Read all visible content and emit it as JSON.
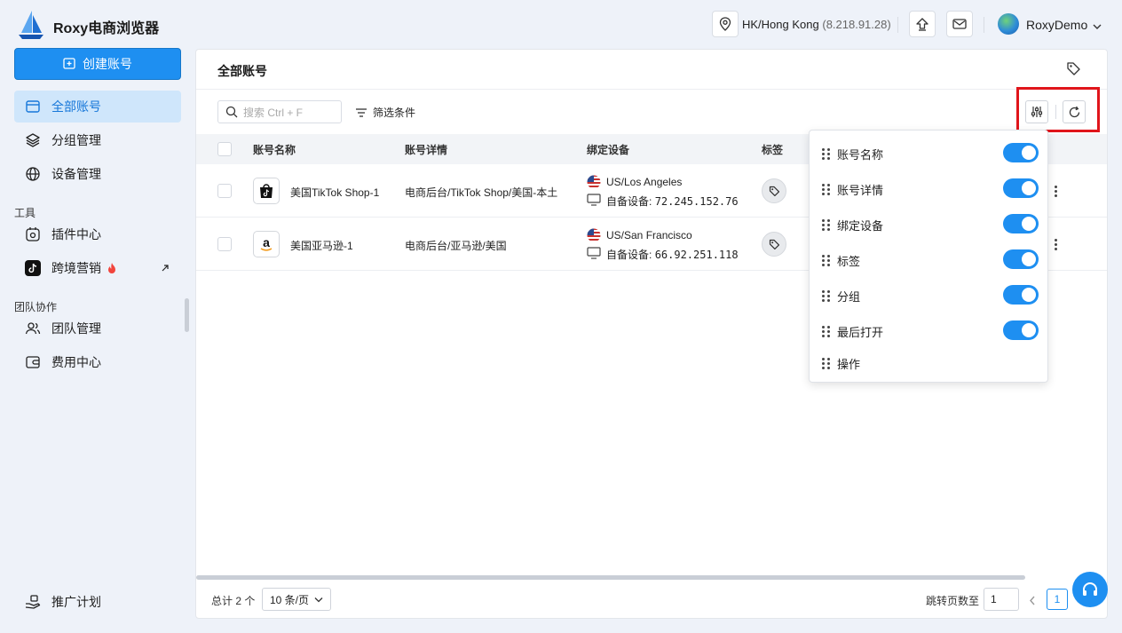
{
  "app": {
    "name": "Roxy电商浏览器"
  },
  "header": {
    "location": "HK/Hong Kong",
    "ip": "(8.218.91.28)",
    "user": "RoxyDemo"
  },
  "sidebar": {
    "create_button": "创建账号",
    "items": [
      {
        "label": "全部账号",
        "active": true
      },
      {
        "label": "分组管理"
      },
      {
        "label": "设备管理"
      }
    ],
    "section_tools": "工具",
    "tools": [
      {
        "label": "插件中心"
      },
      {
        "label": "跨境营销"
      }
    ],
    "section_team": "团队协作",
    "team": [
      {
        "label": "团队管理"
      },
      {
        "label": "费用中心"
      }
    ],
    "bottom_item": "推广计划"
  },
  "main": {
    "title": "全部账号",
    "search_placeholder": "搜索 Ctrl + F",
    "filter_label": "筛选条件",
    "columns": [
      "账号名称",
      "账号详情",
      "绑定设备",
      "标签"
    ],
    "rows": [
      {
        "icon": "tiktok-shop-icon",
        "name": "美国TikTok Shop-1",
        "detail": "电商后台/TikTok Shop/美国-本土",
        "location": "US/Los Angeles",
        "device_label": "自备设备:",
        "device_ip": "72.245.152.76"
      },
      {
        "icon": "amazon-icon",
        "name": "美国亚马逊-1",
        "detail": "电商后台/亚马逊/美国",
        "location": "US/San Francisco",
        "device_label": "自备设备:",
        "device_ip": "66.92.251.118"
      }
    ]
  },
  "column_settings": {
    "items": [
      {
        "label": "账号名称",
        "enabled": true
      },
      {
        "label": "账号详情",
        "enabled": true
      },
      {
        "label": "绑定设备",
        "enabled": true
      },
      {
        "label": "标签",
        "enabled": true
      },
      {
        "label": "分组",
        "enabled": true
      },
      {
        "label": "最后打开",
        "enabled": true
      },
      {
        "label": "操作"
      }
    ]
  },
  "footer": {
    "total": "总计 2 个",
    "page_size": "10 条/页",
    "jump_label": "跳转页数至",
    "jump_value": "1",
    "current_page": "1"
  },
  "colors": {
    "accent": "#1e8ff1",
    "highlight_box": "#e0151b",
    "active_nav_bg": "#cfe6fb"
  }
}
